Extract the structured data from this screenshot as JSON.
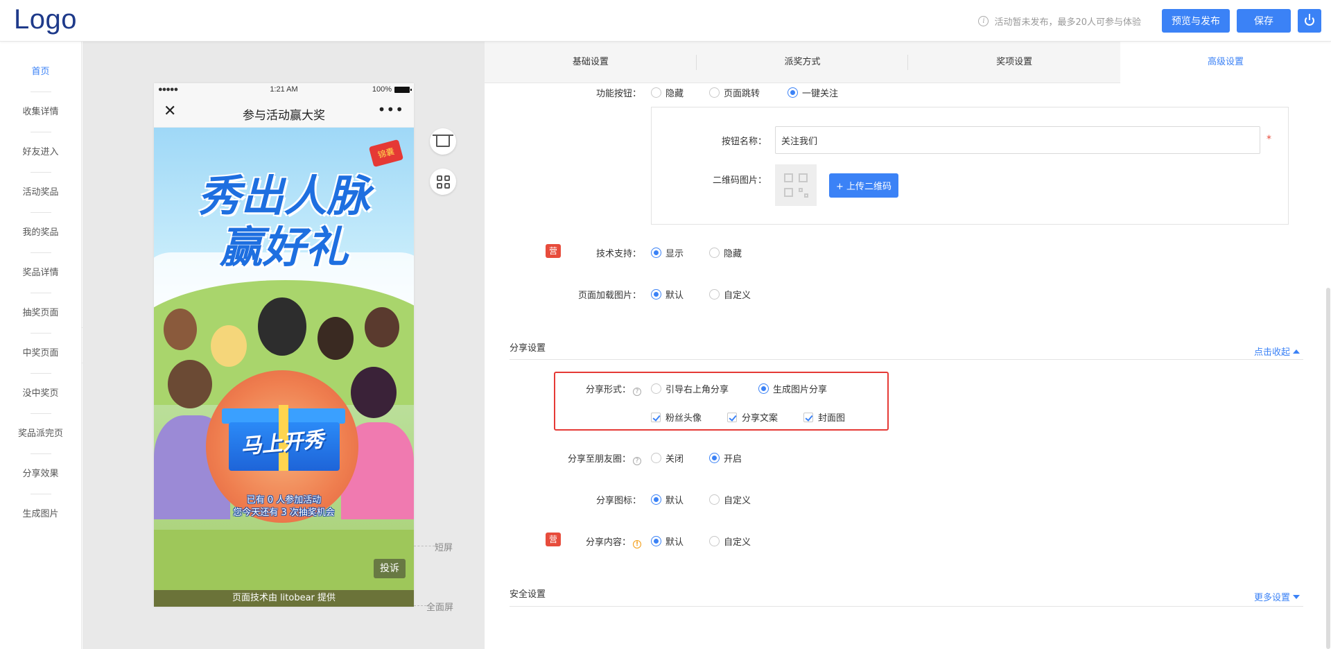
{
  "header": {
    "logo": "Logo",
    "notice": "活动暂未发布，最多20人可参与体验",
    "preview_publish": "预览与发布",
    "save": "保存"
  },
  "sidebar": {
    "items": [
      "首页",
      "收集详情",
      "好友进入",
      "活动奖品",
      "我的奖品",
      "奖品详情",
      "抽奖页面",
      "中奖页面",
      "没中奖页",
      "奖品派完页",
      "分享效果",
      "生成图片"
    ],
    "active": "首页",
    "collapse": "«"
  },
  "phone": {
    "signal": "●●●●●",
    "time": "1:21 AM",
    "battery": "100%",
    "close": "✕",
    "title": "参与活动赢大奖",
    "more": "•••",
    "poster": {
      "headline1": "秀出人脉",
      "headline2": "赢好礼",
      "flag": "锦囊",
      "cta": "马上开秀",
      "line1": "已有 0 人参加活动",
      "line2": "您今天还有 3 次抽奖机会"
    },
    "complain": "投诉",
    "footer": "页面技术由 litobear 提供"
  },
  "screen_labels": {
    "short": "短屏",
    "full": "全面屏"
  },
  "tabs": [
    "基础设置",
    "派奖方式",
    "奖项设置",
    "高级设置"
  ],
  "active_tab": "高级设置",
  "settings": {
    "func_button": {
      "label": "功能按钮：",
      "options": [
        "隐藏",
        "页面跳转",
        "一键关注"
      ],
      "selected": "一键关注"
    },
    "button_name": {
      "label": "按钮名称：",
      "value": "关注我们",
      "required": "*"
    },
    "qr_image": {
      "label": "二维码图片：",
      "upload": "+ 上传二维码"
    },
    "tech_support": {
      "badge": "营",
      "label": "技术支持：",
      "options": [
        "显示",
        "隐藏"
      ],
      "selected": "显示"
    },
    "loading_image": {
      "label": "页面加载图片：",
      "options": [
        "默认",
        "自定义"
      ],
      "selected": "默认"
    },
    "share_section": {
      "title": "分享设置",
      "toggle": "点击收起"
    },
    "share_form": {
      "label": "分享形式：",
      "options": [
        "引导右上角分享",
        "生成图片分享"
      ],
      "selected": "生成图片分享",
      "checks": [
        "粉丝头像",
        "分享文案",
        "封面图"
      ]
    },
    "share_moments": {
      "label": "分享至朋友圈：",
      "options": [
        "关闭",
        "开启"
      ],
      "selected": "开启"
    },
    "share_icon": {
      "label": "分享图标：",
      "options": [
        "默认",
        "自定义"
      ],
      "selected": "默认"
    },
    "share_content": {
      "badge": "营",
      "label": "分享内容：",
      "options": [
        "默认",
        "自定义"
      ],
      "selected": "默认"
    },
    "security_section": {
      "title": "安全设置",
      "toggle": "更多设置"
    }
  }
}
